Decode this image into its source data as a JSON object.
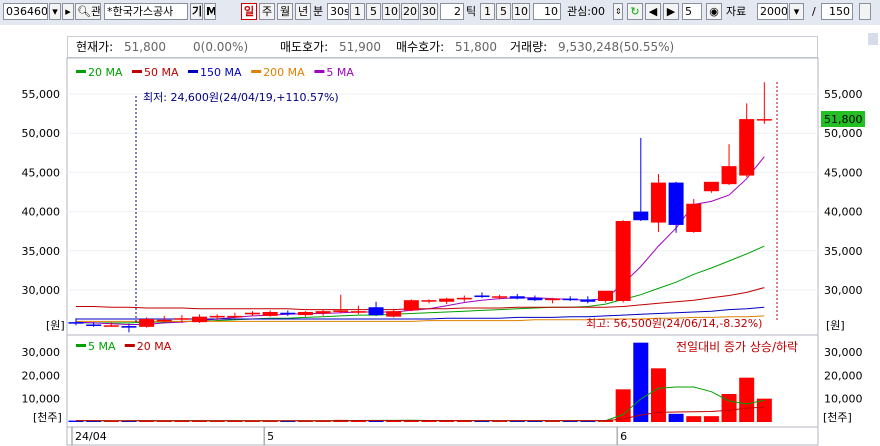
{
  "toolbar": {
    "code": "036460",
    "search_label": "관",
    "stock_name": "*한국가스공사",
    "gi_label": "기",
    "m_label": "M",
    "periods": [
      "일",
      "주",
      "월",
      "년",
      "분"
    ],
    "minute_value": "30s",
    "minute_buttons": [
      "1",
      "5",
      "10",
      "20",
      "30"
    ],
    "tick_value": "2",
    "tick_label": "틱",
    "tick_buttons": [
      "1",
      "5",
      "10"
    ],
    "tick_field": "10",
    "interest_label": "관심:00",
    "step_value": "5",
    "data_label": "자료",
    "data_count": "2000",
    "slash": "/",
    "view_count": "150"
  },
  "info": {
    "current_label": "현재가:",
    "current_value": "51,800",
    "change": "0(0.00%)",
    "ask_label": "매도호가:",
    "ask_value": "51,900",
    "bid_label": "매수호가:",
    "bid_value": "51,800",
    "volume_label": "거래량:",
    "volume_value": "9,530,248(50.55%)"
  },
  "price_legend": [
    {
      "label": "20 MA",
      "color": "#00a000"
    },
    {
      "label": "50 MA",
      "color": "#c00000"
    },
    {
      "label": "150 MA",
      "color": "#0000c0"
    },
    {
      "label": "200 MA",
      "color": "#e08000"
    },
    {
      "label": "5 MA",
      "color": "#a000c0"
    }
  ],
  "volume_legend": [
    {
      "label": "5 MA",
      "color": "#00a000"
    },
    {
      "label": "20 MA",
      "color": "#c00000"
    }
  ],
  "annotations": {
    "low": "최저: 24,600원(24/04/19,+110.57%)",
    "high": "최고: 56,500원(24/06/14,-8.32%)",
    "volume_note": "전일대비 증가 상승/하락"
  },
  "price_axis": {
    "ticks": [
      "55,000",
      "50,000",
      "45,000",
      "40,000",
      "35,000",
      "30,000"
    ],
    "unit": "[원]",
    "current_tag": "51,800"
  },
  "volume_axis": {
    "ticks": [
      "30,000",
      "20,000",
      "10,000"
    ],
    "unit": "[천주]"
  },
  "date_axis": [
    "24/04",
    "5",
    "6"
  ],
  "colors": {
    "up": "#ff0000",
    "down": "#0000ff",
    "tag_bg": "#22c022"
  },
  "chart_data": {
    "type": "candlestick",
    "y_range": [
      24600,
      57000
    ],
    "volume_range": [
      0,
      36000
    ],
    "candles": [
      [
        25900,
        26400,
        25500,
        25800
      ],
      [
        25600,
        25900,
        25300,
        25500
      ],
      [
        25500,
        25900,
        25300,
        25500
      ],
      [
        25400,
        25700,
        24600,
        25200
      ],
      [
        25300,
        26500,
        25200,
        26300
      ],
      [
        26000,
        26700,
        25900,
        26200
      ],
      [
        26300,
        26800,
        25800,
        26400
      ],
      [
        25900,
        26900,
        25800,
        26600
      ],
      [
        26500,
        26900,
        26100,
        26700
      ],
      [
        26600,
        27100,
        26400,
        26700
      ],
      [
        26900,
        27300,
        26700,
        27100
      ],
      [
        26700,
        27400,
        26600,
        27200
      ],
      [
        27100,
        27400,
        26700,
        26900
      ],
      [
        26800,
        27300,
        26600,
        27200
      ],
      [
        27000,
        27500,
        26700,
        27300
      ],
      [
        27200,
        29400,
        27000,
        27400
      ],
      [
        27100,
        28000,
        26900,
        27300
      ],
      [
        27800,
        28500,
        26700,
        26800
      ],
      [
        26600,
        27600,
        26500,
        27300
      ],
      [
        27400,
        28800,
        27300,
        28700
      ],
      [
        28600,
        28800,
        28300,
        28700
      ],
      [
        28500,
        29000,
        28200,
        28900
      ],
      [
        28800,
        29300,
        28500,
        29000
      ],
      [
        29300,
        29700,
        29000,
        29100
      ],
      [
        29100,
        29400,
        28800,
        29200
      ],
      [
        29200,
        29500,
        28800,
        28900
      ],
      [
        29000,
        29300,
        28600,
        28700
      ],
      [
        28700,
        29000,
        28300,
        28900
      ],
      [
        28900,
        29200,
        28600,
        28700
      ],
      [
        28800,
        29200,
        28300,
        28500
      ],
      [
        28600,
        29800,
        28400,
        29900
      ],
      [
        28600,
        38900,
        28400,
        38800
      ],
      [
        40000,
        49400,
        38800,
        38900
      ],
      [
        38600,
        44800,
        37400,
        43700
      ],
      [
        43700,
        43800,
        37300,
        38300
      ],
      [
        37400,
        41600,
        37300,
        41000
      ],
      [
        42600,
        43500,
        42400,
        43800
      ],
      [
        43500,
        48600,
        43400,
        45800
      ],
      [
        44600,
        53800,
        44400,
        51800
      ],
      [
        51800,
        56500,
        51200,
        51800
      ]
    ],
    "volumes": [
      600,
      500,
      500,
      600,
      700,
      500,
      600,
      500,
      500,
      600,
      500,
      600,
      500,
      500,
      500,
      900,
      700,
      800,
      500,
      700,
      600,
      600,
      500,
      500,
      500,
      500,
      500,
      500,
      500,
      500,
      700,
      14000,
      34000,
      23000,
      3500,
      2500,
      2500,
      12000,
      19000,
      10000
    ],
    "ma": {
      "20 MA": [
        25800,
        25800,
        25800,
        25800,
        25900,
        25900,
        26000,
        26000,
        26100,
        26200,
        26300,
        26400,
        26400,
        26500,
        26600,
        26700,
        26800,
        26800,
        26900,
        27000,
        27100,
        27200,
        27300,
        27400,
        27500,
        27600,
        27700,
        27800,
        27800,
        27900,
        28200,
        28800,
        29400,
        30200,
        31000,
        32000,
        32800,
        33700,
        34600,
        35600
      ],
      "5 MA": [
        25900,
        25800,
        25700,
        25600,
        25600,
        25800,
        25900,
        26100,
        26300,
        26500,
        26700,
        26800,
        26900,
        27000,
        27000,
        27100,
        27200,
        27200,
        27200,
        27400,
        27600,
        28000,
        28400,
        28700,
        28900,
        29000,
        29000,
        28900,
        28800,
        28700,
        28900,
        30800,
        33000,
        35600,
        37900,
        40900,
        41300,
        42100,
        44200,
        47000
      ],
      "50 MA": [
        27900,
        27900,
        27800,
        27800,
        27700,
        27700,
        27700,
        27600,
        27600,
        27600,
        27600,
        27600,
        27600,
        27500,
        27500,
        27500,
        27500,
        27500,
        27500,
        27600,
        27600,
        27600,
        27700,
        27700,
        27700,
        27800,
        27800,
        27800,
        27800,
        27800,
        27800,
        27900,
        28100,
        28300,
        28500,
        28700,
        29000,
        29300,
        29700,
        30300
      ],
      "150 MA": [
        26300,
        26300,
        26300,
        26300,
        26300,
        26300,
        26300,
        26300,
        26300,
        26300,
        26300,
        26300,
        26300,
        26300,
        26300,
        26300,
        26300,
        26300,
        26300,
        26300,
        26300,
        26400,
        26400,
        26400,
        26400,
        26500,
        26500,
        26500,
        26600,
        26600,
        26700,
        26800,
        26900,
        27000,
        27100,
        27200,
        27300,
        27500,
        27600,
        27800
      ],
      "200 MA": [
        26000,
        26000,
        26000,
        26000,
        26000,
        26000,
        26000,
        26000,
        26000,
        26000,
        26000,
        26000,
        26000,
        26000,
        26000,
        26000,
        26000,
        26000,
        26000,
        26000,
        26100,
        26100,
        26100,
        26100,
        26100,
        26100,
        26200,
        26200,
        26200,
        26200,
        26300,
        26300,
        26300,
        26400,
        26400,
        26500,
        26500,
        26600,
        26600,
        26700
      ]
    },
    "volume_ma": {
      "5 MA": [
        600,
        560,
        540,
        560,
        580,
        560,
        580,
        580,
        560,
        580,
        560,
        560,
        540,
        540,
        540,
        620,
        640,
        680,
        680,
        720,
        660,
        660,
        620,
        560,
        560,
        520,
        500,
        500,
        500,
        500,
        540,
        3200,
        9900,
        14500,
        15000,
        15000,
        13000,
        9000,
        7700,
        9300
      ],
      "20 MA": [
        600,
        580,
        560,
        560,
        570,
        570,
        570,
        570,
        570,
        570,
        570,
        570,
        570,
        560,
        560,
        570,
        580,
        590,
        590,
        600,
        600,
        600,
        600,
        600,
        600,
        600,
        600,
        600,
        600,
        600,
        600,
        1300,
        3000,
        4100,
        4300,
        4400,
        4500,
        5000,
        5900,
        6400
      ]
    }
  }
}
